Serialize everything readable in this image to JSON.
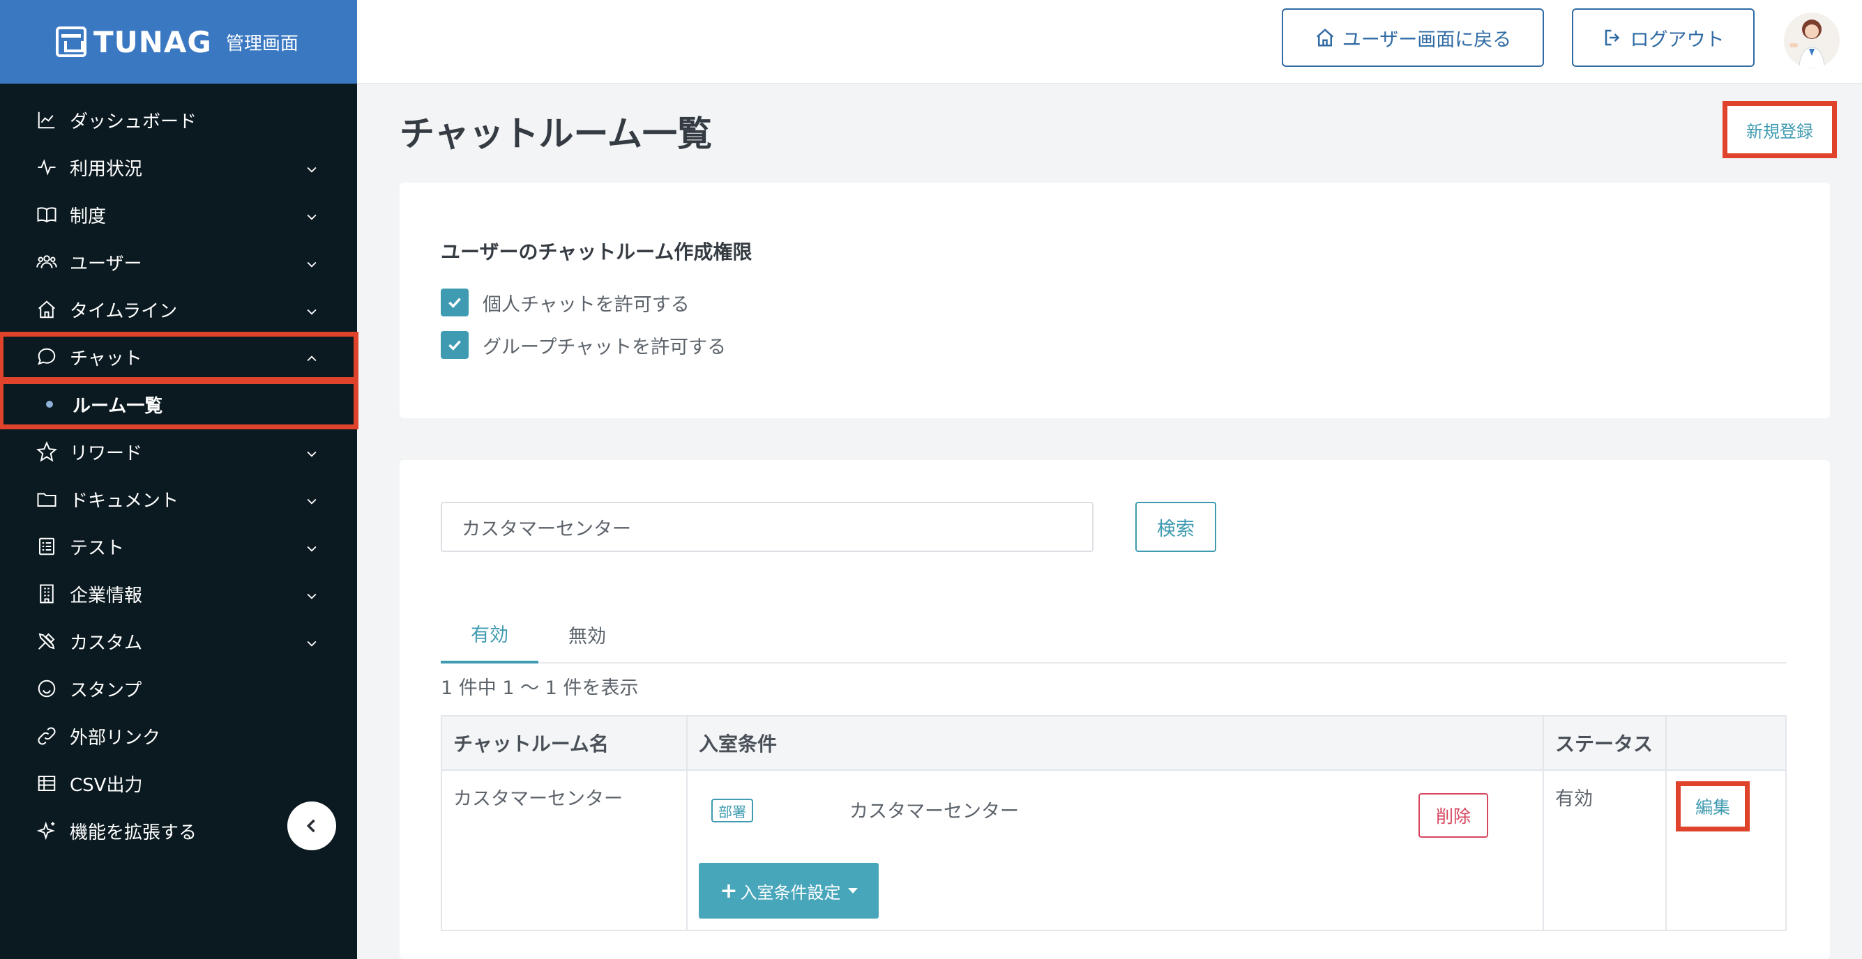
{
  "brand": {
    "name": "TUNAG",
    "subtitle": "管理画面"
  },
  "sidebar": {
    "items": [
      {
        "label": "ダッシュボード",
        "icon": "chart-line-icon",
        "expandable": false
      },
      {
        "label": "利用状況",
        "icon": "activity-icon",
        "expandable": true
      },
      {
        "label": "制度",
        "icon": "book-icon",
        "expandable": true
      },
      {
        "label": "ユーザー",
        "icon": "users-icon",
        "expandable": true
      },
      {
        "label": "タイムライン",
        "icon": "home-icon",
        "expandable": true
      },
      {
        "label": "チャット",
        "icon": "chat-bubble-icon",
        "expandable": true,
        "expanded": true,
        "highlighted": true
      },
      {
        "label": "リワード",
        "icon": "star-icon",
        "expandable": true
      },
      {
        "label": "ドキュメント",
        "icon": "folder-icon",
        "expandable": true
      },
      {
        "label": "テスト",
        "icon": "checklist-icon",
        "expandable": true
      },
      {
        "label": "企業情報",
        "icon": "building-icon",
        "expandable": true
      },
      {
        "label": "カスタム",
        "icon": "tools-icon",
        "expandable": true
      },
      {
        "label": "スタンプ",
        "icon": "smiley-icon",
        "expandable": false
      },
      {
        "label": "外部リンク",
        "icon": "link-icon",
        "expandable": false
      },
      {
        "label": "CSV出力",
        "icon": "table-icon",
        "expandable": false
      },
      {
        "label": "機能を拡張する",
        "icon": "sparkle-icon",
        "expandable": false
      }
    ],
    "chat_sub_item": "ルーム一覧"
  },
  "header": {
    "back_label": "ユーザー画面に戻る",
    "logout_label": "ログアウト"
  },
  "main": {
    "title": "チャットルーム一覧",
    "new_label": "新規登録",
    "permissions": {
      "title": "ユーザーのチャットルーム作成権限",
      "options": [
        {
          "label": "個人チャットを許可する",
          "checked": true
        },
        {
          "label": "グループチャットを許可する",
          "checked": true
        }
      ]
    },
    "search": {
      "value": "カスタマーセンター",
      "button": "検索"
    },
    "tabs": [
      {
        "label": "有効",
        "active": true
      },
      {
        "label": "無効",
        "active": false
      }
    ],
    "count_text": "1 件中 1 〜 1 件を表示",
    "table": {
      "headers": [
        "チャットルーム名",
        "入室条件",
        "ステータス",
        ""
      ],
      "rows": [
        {
          "name": "カスタマーセンター",
          "condition_type": "部署",
          "condition_value": "カスタマーセンター",
          "delete_label": "削除",
          "add_condition_label": "入室条件設定",
          "status": "有効",
          "edit_label": "編集"
        }
      ]
    }
  },
  "colors": {
    "brand": "#3a78c2",
    "sidebar": "#0b1a20",
    "accent": "#3f9bb1",
    "highlight": "#e0432b",
    "danger": "#d6455d"
  }
}
